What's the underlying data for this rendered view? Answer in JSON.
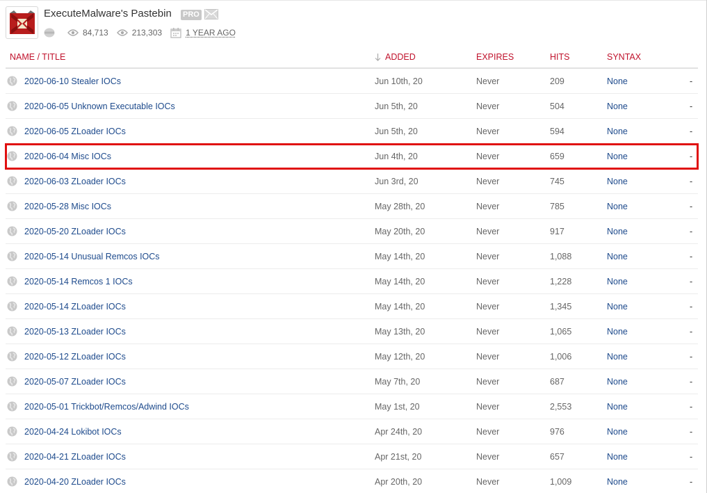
{
  "profile": {
    "username": "ExecuteMalware's Pastebin",
    "badge": "PRO",
    "views_today": "84,713",
    "views_total": "213,303",
    "member_since": "1 YEAR AGO",
    "avatar_icon": "malware-logo-icon",
    "mail_icon": "envelope-icon"
  },
  "table": {
    "headers": {
      "name": "NAME / TITLE",
      "added": "ADDED",
      "expires": "EXPIRES",
      "hits": "HITS",
      "syntax": "SYNTAX"
    },
    "rows": [
      {
        "title": "2020-06-10 Stealer IOCs",
        "added": "Jun 10th, 20",
        "expires": "Never",
        "hits": "209",
        "syntax": "None",
        "extra": "-"
      },
      {
        "title": "2020-06-05 Unknown Executable IOCs",
        "added": "Jun 5th, 20",
        "expires": "Never",
        "hits": "504",
        "syntax": "None",
        "extra": "-"
      },
      {
        "title": "2020-06-05 ZLoader IOCs",
        "added": "Jun 5th, 20",
        "expires": "Never",
        "hits": "594",
        "syntax": "None",
        "extra": "-"
      },
      {
        "title": "2020-06-04 Misc IOCs",
        "added": "Jun 4th, 20",
        "expires": "Never",
        "hits": "659",
        "syntax": "None",
        "extra": "-"
      },
      {
        "title": "2020-06-03 ZLoader IOCs",
        "added": "Jun 3rd, 20",
        "expires": "Never",
        "hits": "745",
        "syntax": "None",
        "extra": "-"
      },
      {
        "title": "2020-05-28 Misc IOCs",
        "added": "May 28th, 20",
        "expires": "Never",
        "hits": "785",
        "syntax": "None",
        "extra": "-"
      },
      {
        "title": "2020-05-20 ZLoader IOCs",
        "added": "May 20th, 20",
        "expires": "Never",
        "hits": "917",
        "syntax": "None",
        "extra": "-"
      },
      {
        "title": "2020-05-14 Unusual Remcos IOCs",
        "added": "May 14th, 20",
        "expires": "Never",
        "hits": "1,088",
        "syntax": "None",
        "extra": "-"
      },
      {
        "title": "2020-05-14 Remcos 1 IOCs",
        "added": "May 14th, 20",
        "expires": "Never",
        "hits": "1,228",
        "syntax": "None",
        "extra": "-"
      },
      {
        "title": "2020-05-14 ZLoader IOCs",
        "added": "May 14th, 20",
        "expires": "Never",
        "hits": "1,345",
        "syntax": "None",
        "extra": "-"
      },
      {
        "title": "2020-05-13 ZLoader IOCs",
        "added": "May 13th, 20",
        "expires": "Never",
        "hits": "1,065",
        "syntax": "None",
        "extra": "-"
      },
      {
        "title": "2020-05-12 ZLoader IOCs",
        "added": "May 12th, 20",
        "expires": "Never",
        "hits": "1,006",
        "syntax": "None",
        "extra": "-"
      },
      {
        "title": "2020-05-07 ZLoader IOCs",
        "added": "May 7th, 20",
        "expires": "Never",
        "hits": "687",
        "syntax": "None",
        "extra": "-"
      },
      {
        "title": "2020-05-01 Trickbot/Remcos/Adwind IOCs",
        "added": "May 1st, 20",
        "expires": "Never",
        "hits": "2,553",
        "syntax": "None",
        "extra": "-"
      },
      {
        "title": "2020-04-24 Lokibot IOCs",
        "added": "Apr 24th, 20",
        "expires": "Never",
        "hits": "976",
        "syntax": "None",
        "extra": "-"
      },
      {
        "title": "2020-04-21 ZLoader IOCs",
        "added": "Apr 21st, 20",
        "expires": "Never",
        "hits": "657",
        "syntax": "None",
        "extra": "-"
      },
      {
        "title": "2020-04-20 ZLoader IOCs",
        "added": "Apr 20th, 20",
        "expires": "Never",
        "hits": "1,009",
        "syntax": "None",
        "extra": "-"
      }
    ],
    "highlighted_row_title": "2020-06-04 Misc IOCs"
  },
  "colors": {
    "header_red": "#c0122c",
    "link_blue": "#1d4a8c",
    "highlight_border": "#e01010"
  }
}
